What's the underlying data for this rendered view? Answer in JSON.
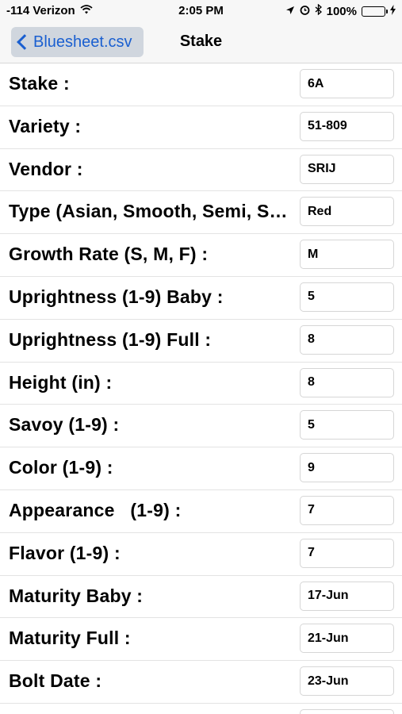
{
  "status_bar": {
    "carrier": "-114 Verizon",
    "time": "2:05 PM",
    "battery_percent": "100%",
    "colors": {
      "battery": "#4cd964"
    }
  },
  "nav": {
    "back_label": "Bluesheet.csv",
    "title": "Stake",
    "colors": {
      "back_tint": "#1a5fd0",
      "back_bg": "#d0d6de"
    }
  },
  "rows": [
    {
      "label": "Stake :",
      "value": "6A"
    },
    {
      "label": "Variety :",
      "value": "51-809"
    },
    {
      "label": "Vendor :",
      "value": "SRIJ"
    },
    {
      "label": "Type (Asian, Smooth, Semi, Savoy, Red) :",
      "value": "Red"
    },
    {
      "label": "Growth Rate (S, M, F) :",
      "value": "M"
    },
    {
      "label": "Uprightness (1-9) Baby :",
      "value": "5"
    },
    {
      "label": "Uprightness (1-9) Full :",
      "value": "8"
    },
    {
      "label": "Height (in) :",
      "value": "8"
    },
    {
      "label": "Savoy (1-9) :",
      "value": "5"
    },
    {
      "label": "Color (1-9) :",
      "value": "9"
    },
    {
      "label": "Appearance   (1-9) :",
      "value": "7"
    },
    {
      "label": "Flavor (1-9) :",
      "value": "7"
    },
    {
      "label": "Maturity Baby :",
      "value": "17-Jun"
    },
    {
      "label": "Maturity Full :",
      "value": "21-Jun"
    },
    {
      "label": "Bolt Date :",
      "value": "23-Jun"
    },
    {
      "label": "",
      "value": ""
    }
  ],
  "icons": [
    "wifi-icon",
    "location-icon",
    "alarm-icon",
    "bluetooth-icon",
    "battery-icon",
    "charging-icon",
    "back-chevron-icon"
  ]
}
